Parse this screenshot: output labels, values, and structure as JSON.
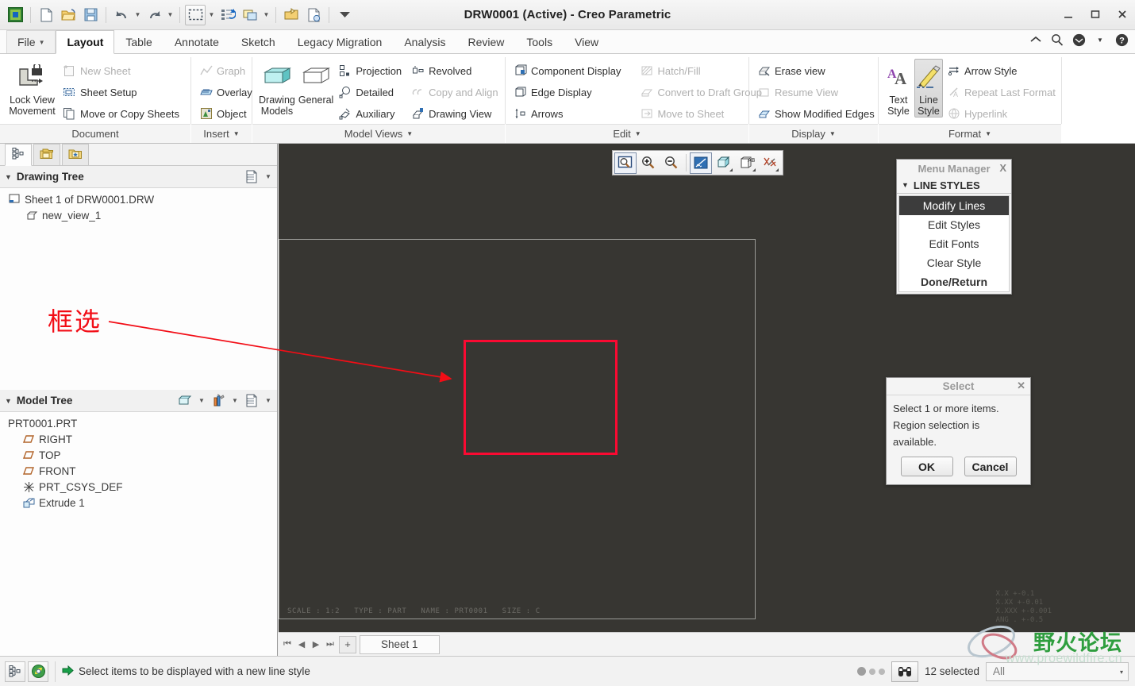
{
  "window": {
    "title": "DRW0001 (Active) - Creo Parametric",
    "minimize": "—",
    "maximize": "▢",
    "close": "✕"
  },
  "quick_access": {
    "items": [
      {
        "name": "creo-logo-icon",
        "label": "Creo"
      },
      {
        "name": "new-file-icon",
        "label": "New"
      },
      {
        "name": "open-folder-icon",
        "label": "Open"
      },
      {
        "name": "save-icon",
        "label": "Save"
      },
      {
        "name": "undo-icon",
        "label": "Undo"
      },
      {
        "name": "redo-icon",
        "label": "Redo"
      },
      {
        "name": "regenerate-icon",
        "label": "Regenerate"
      },
      {
        "name": "window-list-icon",
        "label": "Window"
      },
      {
        "name": "close-window-icon",
        "label": "Close"
      },
      {
        "name": "open-in-browser-icon",
        "label": "Browser"
      },
      {
        "name": "customize-qat-icon",
        "label": "Customize Quick Access Toolbar"
      }
    ]
  },
  "help_icons": [
    {
      "name": "minimize-ribbon-icon",
      "label": "^"
    },
    {
      "name": "search-icon",
      "label": "search"
    },
    {
      "name": "ptc-account-icon",
      "label": "account"
    },
    {
      "name": "help-icon",
      "label": "?"
    }
  ],
  "tabs": [
    {
      "label": "File",
      "name": "tab-file",
      "active": false,
      "has_caret": true
    },
    {
      "label": "Layout",
      "name": "tab-layout",
      "active": true
    },
    {
      "label": "Table",
      "name": "tab-table",
      "active": false
    },
    {
      "label": "Annotate",
      "name": "tab-annotate",
      "active": false
    },
    {
      "label": "Sketch",
      "name": "tab-sketch",
      "active": false
    },
    {
      "label": "Legacy Migration",
      "name": "tab-legacy-migration",
      "active": false
    },
    {
      "label": "Analysis",
      "name": "tab-analysis",
      "active": false
    },
    {
      "label": "Review",
      "name": "tab-review",
      "active": false
    },
    {
      "label": "Tools",
      "name": "tab-tools",
      "active": false
    },
    {
      "label": "View",
      "name": "tab-view",
      "active": false
    }
  ],
  "ribbon": {
    "groups": [
      {
        "name": "document",
        "label": "Document",
        "has_caret": false,
        "big": [
          {
            "label_line1": "Lock View",
            "label_line2": "Movement",
            "icon": "lock-view-movement-icon",
            "selected": false
          }
        ],
        "small": [
          {
            "label": "New Sheet",
            "icon": "new-sheet-icon",
            "disabled": true
          },
          {
            "label": "Sheet Setup",
            "icon": "sheet-setup-icon",
            "disabled": false
          },
          {
            "label": "Move or Copy Sheets",
            "icon": "move-copy-sheets-icon",
            "disabled": false
          }
        ]
      },
      {
        "name": "insert",
        "label": "Insert",
        "has_caret": true,
        "big": [],
        "small": [
          {
            "label": "Graph",
            "icon": "graph-icon",
            "disabled": true
          },
          {
            "label": "Overlay",
            "icon": "overlay-icon",
            "disabled": false
          },
          {
            "label": "Object",
            "icon": "object-icon",
            "disabled": false
          }
        ]
      },
      {
        "name": "model-views",
        "label": "Model Views",
        "has_caret": true,
        "big": [
          {
            "label_line1": "Drawing",
            "label_line2": "Models",
            "icon": "drawing-models-icon",
            "selected": false
          },
          {
            "label_line1": "General",
            "label_line2": "",
            "icon": "general-view-icon",
            "selected": false
          }
        ],
        "small": [
          {
            "label": "Projection",
            "icon": "projection-view-icon",
            "disabled": false
          },
          {
            "label": "Detailed",
            "icon": "detailed-view-icon",
            "disabled": false
          },
          {
            "label": "Auxiliary",
            "icon": "auxiliary-view-icon",
            "disabled": false
          }
        ],
        "small2": [
          {
            "label": "Revolved",
            "icon": "revolved-view-icon",
            "disabled": false
          },
          {
            "label": "Copy and Align",
            "icon": "copy-and-align-icon",
            "disabled": true
          },
          {
            "label": "Drawing View",
            "icon": "drawing-view-icon",
            "disabled": false
          }
        ]
      },
      {
        "name": "edit",
        "label": "Edit",
        "has_caret": true,
        "big": [],
        "small": [
          {
            "label": "Component Display",
            "icon": "component-display-icon",
            "disabled": false
          },
          {
            "label": "Edge Display",
            "icon": "edge-display-icon",
            "disabled": false
          },
          {
            "label": "Arrows",
            "icon": "arrows-icon",
            "disabled": false
          }
        ],
        "small2": [
          {
            "label": "Hatch/Fill",
            "icon": "hatch-fill-icon",
            "disabled": true
          },
          {
            "label": "Convert to Draft Group",
            "icon": "convert-draft-group-icon",
            "disabled": true
          },
          {
            "label": "Move to Sheet",
            "icon": "move-to-sheet-icon",
            "disabled": true
          }
        ]
      },
      {
        "name": "display",
        "label": "Display",
        "has_caret": true,
        "big": [],
        "small": [
          {
            "label": "Erase view",
            "icon": "erase-view-icon",
            "disabled": false
          },
          {
            "label": "Resume View",
            "icon": "resume-view-icon",
            "disabled": true
          },
          {
            "label": "Show Modified Edges",
            "icon": "show-modified-edges-icon",
            "disabled": false
          }
        ]
      },
      {
        "name": "format",
        "label": "Format",
        "has_caret": true,
        "big": [
          {
            "label_line1": "Text",
            "label_line2": "Style",
            "icon": "text-style-icon",
            "selected": false
          },
          {
            "label_line1": "Line",
            "label_line2": "Style",
            "icon": "line-style-icon",
            "selected": true
          }
        ],
        "small": [
          {
            "label": "Arrow Style",
            "icon": "arrow-style-icon",
            "disabled": false
          },
          {
            "label": "Repeat Last Format",
            "icon": "repeat-last-format-icon",
            "disabled": true
          },
          {
            "label": "Hyperlink",
            "icon": "hyperlink-icon",
            "disabled": true
          }
        ]
      }
    ]
  },
  "navigator": {
    "tabs": [
      {
        "name": "model-tree-tab",
        "icon": "model-tree-icon",
        "active": true
      },
      {
        "name": "folder-browser-tab",
        "icon": "folder-browser-icon",
        "active": false
      },
      {
        "name": "favorites-tab",
        "icon": "favorites-folder-icon",
        "active": false
      }
    ],
    "drawing_tree": {
      "header": "Drawing Tree",
      "settings_icon": "tree-settings-icon",
      "caret": "▾",
      "nodes": [
        {
          "label": "Sheet 1 of DRW0001.DRW",
          "icon": "sheet-icon",
          "indent": 0
        },
        {
          "label": "new_view_1",
          "icon": "view-icon",
          "indent": 1
        }
      ]
    },
    "model_tree": {
      "header": "Model Tree",
      "icons": [
        "display-style-icon",
        "tools-icon",
        "tree-settings-icon"
      ],
      "caret": "▾",
      "nodes": [
        {
          "label": "PRT0001.PRT",
          "icon": "part-icon",
          "indent": 0
        },
        {
          "label": "RIGHT",
          "icon": "datum-plane-icon",
          "indent": 1
        },
        {
          "label": "TOP",
          "icon": "datum-plane-icon",
          "indent": 1
        },
        {
          "label": "FRONT",
          "icon": "datum-plane-icon",
          "indent": 1
        },
        {
          "label": "PRT_CSYS_DEF",
          "icon": "coordinate-system-icon",
          "indent": 1
        },
        {
          "label": "Extrude 1",
          "icon": "extrude-feature-icon",
          "indent": 1
        }
      ]
    }
  },
  "graphics_toolbar": {
    "buttons": [
      {
        "name": "refit-icon",
        "label": "Refit",
        "framed": true
      },
      {
        "name": "zoom-in-icon",
        "label": "Zoom In",
        "framed": false
      },
      {
        "name": "zoom-out-icon",
        "label": "Zoom Out",
        "framed": false
      },
      {
        "name": "repaint-icon",
        "label": "Repaint",
        "framed": false
      },
      {
        "name": "display-style-icon",
        "label": "Display Style",
        "framed": false,
        "corner": true
      },
      {
        "name": "annotation-display-icon",
        "label": "Annotation Display",
        "framed": false,
        "corner": true
      },
      {
        "name": "datum-display-icon",
        "label": "Datum Display Filters",
        "framed": false,
        "corner": true
      }
    ]
  },
  "canvas": {
    "sheet_info": [
      "SCALE : 1:2",
      "TYPE : PART",
      "NAME : PRT0001",
      "SIZE : C"
    ],
    "tolerance_block": [
      "X.X   +-0.1",
      "X.XX  +-0.01",
      "X.XXX +-0.001",
      "ANG . +-0.5"
    ],
    "selection_box_color": "#fa0a32"
  },
  "menu_manager": {
    "title": "Menu Manager",
    "close": "X",
    "submenu_title": "LINE STYLES",
    "submenu_caret": "▼",
    "items": [
      {
        "label": "Modify Lines",
        "selected": true,
        "bold": false
      },
      {
        "label": "Edit Styles",
        "selected": false,
        "bold": false
      },
      {
        "label": "Edit Fonts",
        "selected": false,
        "bold": false
      },
      {
        "label": "Clear Style",
        "selected": false,
        "bold": false
      },
      {
        "label": "Done/Return",
        "selected": false,
        "bold": true
      }
    ]
  },
  "select_dialog": {
    "title": "Select",
    "close": "✕",
    "line1": "Select 1 or more items.",
    "line2": "Region selection is available.",
    "ok": "OK",
    "cancel": "Cancel"
  },
  "sheet_bar": {
    "nav": [
      "⏮",
      "◀",
      "▶",
      "⏭"
    ],
    "add_label": "+",
    "tabs": [
      {
        "label": "Sheet 1",
        "active": true
      }
    ]
  },
  "status_bar": {
    "left_icons": [
      {
        "name": "model-tree-toggle-icon",
        "label": "Model Tree"
      },
      {
        "name": "browser-toggle-icon",
        "label": "Web Browser"
      }
    ],
    "message_arrow": "➡",
    "message": "Select items to be displayed with a new line style",
    "selection_count": "12 selected",
    "binoculars_icon": "search-selection-icon",
    "filter_value": "All",
    "filter_caret": "▾"
  },
  "annotations": {
    "label": "框选",
    "color": "#f20d16"
  },
  "watermark": {
    "text": "野火论坛",
    "url": "www.proewildfire.cn"
  }
}
